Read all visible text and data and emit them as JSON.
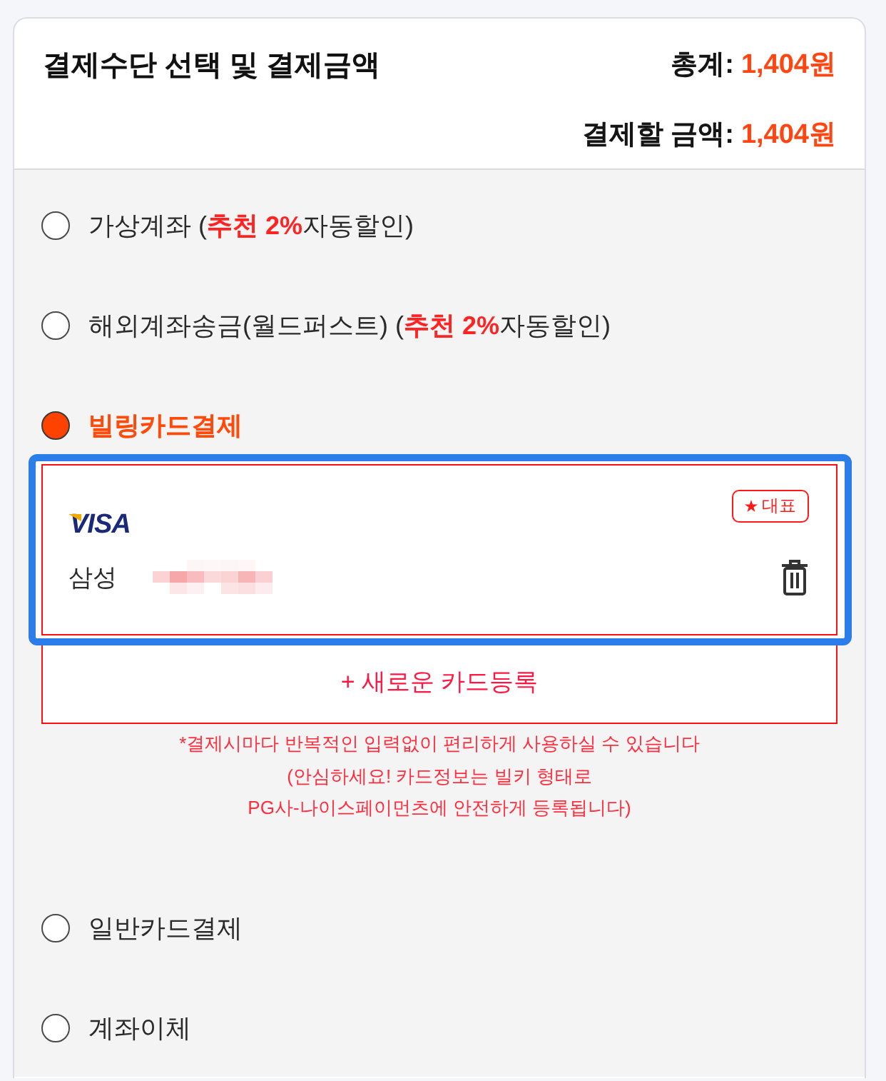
{
  "header": {
    "title": "결제수단 선택 및 결제금액",
    "totals": [
      {
        "label": "총계:",
        "amount": "1,404원"
      },
      {
        "label": "결제할 금액:",
        "amount": "1,404원"
      }
    ]
  },
  "payment_methods": [
    {
      "kind": "option",
      "label": "가상계좌 (**추천 2%**자동할인)",
      "selected": false
    },
    {
      "kind": "option",
      "label": "해외계좌송금(월드퍼스트) (**추천 2%**자동할인)",
      "selected": false
    },
    {
      "kind": "billing",
      "label": "빌링카드결제",
      "selected": true,
      "cards": [
        {
          "brand": "VISA",
          "name": "삼성",
          "badge": "대표",
          "selected": true
        }
      ],
      "add_card_button": "+ 새로운 카드등록",
      "notes": [
        "*결제시마다 반복적인 입력없이 편리하게 사용하실 수 있습니다",
        "(안심하세요! 카드정보는 빌키 형태로\nPG사-나이스페이먼츠에 안전하게 등록됩니다)"
      ]
    },
    {
      "kind": "option",
      "label": "일반카드결제",
      "selected": false
    },
    {
      "kind": "option",
      "label": "계좌이체",
      "selected": false
    }
  ]
}
